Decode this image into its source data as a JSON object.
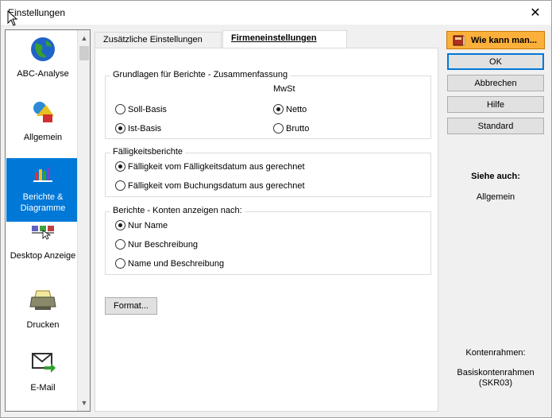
{
  "window": {
    "title": "Einstellungen"
  },
  "categories": [
    {
      "label_line1": "ABC-Analyse",
      "label_line2": "",
      "icon": "globe-icon",
      "selected": false
    },
    {
      "label_line1": "Allgemein",
      "label_line2": "",
      "icon": "shapes-icon",
      "selected": false
    },
    {
      "label_line1": "Berichte &",
      "label_line2": "Diagramme",
      "icon": "bar-chart-icon",
      "selected": true
    },
    {
      "label_line1": "Desktop Anzeige",
      "label_line2": "",
      "icon": "desktop-icon",
      "selected": false
    },
    {
      "label_line1": "Drucken",
      "label_line2": "",
      "icon": "printer-icon",
      "selected": false
    },
    {
      "label_line1": "E-Mail",
      "label_line2": "",
      "icon": "email-icon",
      "selected": false
    }
  ],
  "tabs": [
    {
      "label": "Zusätzliche Einstellungen",
      "active": false
    },
    {
      "label": "Firmeneinstellungen",
      "active": true
    }
  ],
  "groups": {
    "summary": {
      "legend": "Grundlagen für Berichte - Zusammenfassung",
      "mwst_label": "MwSt",
      "options_left": [
        {
          "label": "Soll-Basis",
          "checked": false
        },
        {
          "label": "Ist-Basis",
          "checked": true
        }
      ],
      "options_right": [
        {
          "label": "Netto",
          "checked": true
        },
        {
          "label": "Brutto",
          "checked": false
        }
      ]
    },
    "due": {
      "legend": "Fälligkeitsberichte",
      "options": [
        {
          "label": "Fälligkeit vom Fälligkeitsdatum aus gerechnet",
          "checked": true
        },
        {
          "label": "Fälligkeit vom Buchungsdatum aus gerechnet",
          "checked": false
        }
      ]
    },
    "accounts": {
      "legend": "Berichte - Konten anzeigen nach:",
      "options": [
        {
          "label": "Nur Name",
          "checked": true
        },
        {
          "label": "Nur Beschreibung",
          "checked": false
        },
        {
          "label": "Name und Beschreibung",
          "checked": false
        }
      ]
    }
  },
  "format_button": "Format...",
  "buttons": {
    "howto": "Wie kann man...",
    "ok": "OK",
    "cancel": "Abbrechen",
    "help": "Hilfe",
    "standard": "Standard"
  },
  "see_also": {
    "heading": "Siehe auch:",
    "link": "Allgemein"
  },
  "chart_of_accounts": {
    "label": "Kontenrahmen:",
    "value_line1": "Basiskontenrahmen",
    "value_line2": "(SKR03)"
  },
  "colors": {
    "selection": "#0078d7",
    "howto_button": "#fbb03b"
  }
}
